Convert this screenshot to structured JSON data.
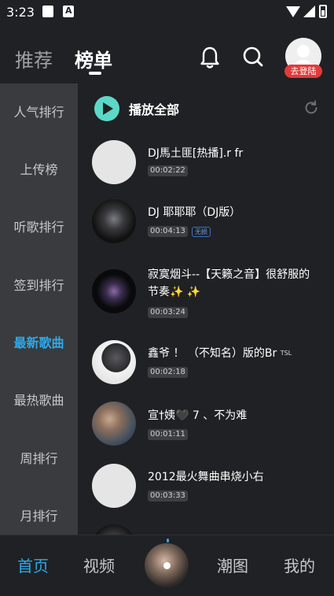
{
  "status_bar": {
    "time": "3:23"
  },
  "header": {
    "tabs": [
      {
        "label": "推荐",
        "active": false
      },
      {
        "label": "榜单",
        "active": true
      }
    ],
    "login_badge": "去登陆"
  },
  "sidebar": {
    "items": [
      {
        "label": "人气排行",
        "active": false
      },
      {
        "label": "上传榜",
        "active": false
      },
      {
        "label": "听歌排行",
        "active": false
      },
      {
        "label": "签到排行",
        "active": false
      },
      {
        "label": "最新歌曲",
        "active": true
      },
      {
        "label": "最热歌曲",
        "active": false
      },
      {
        "label": "周排行",
        "active": false
      },
      {
        "label": "月排行",
        "active": false
      }
    ]
  },
  "list": {
    "play_all_label": "播放全部",
    "songs": [
      {
        "title": "DJ馬土匪[热播].r fr",
        "duration": "00:02:22"
      },
      {
        "title": "DJ  耶耶耶（DJ版）",
        "duration": "00:04:13",
        "tag": "无损"
      },
      {
        "title": "寂寞烟斗--【天籁之音】很舒服的节奏✨ ✨",
        "duration": "00:03:24"
      },
      {
        "title": "鑫爷 ！ （不知名）版的Br",
        "title_sup": "TSL",
        "duration": "00:02:18"
      },
      {
        "title": "宣†姨🖤  7 、不为难",
        "duration": "00:01:11"
      },
      {
        "title": "2012最火舞曲串烧小右",
        "duration": "00:03:33"
      }
    ]
  },
  "bottom_nav": {
    "items": [
      {
        "label": "首页",
        "active": true
      },
      {
        "label": "视频",
        "active": false
      },
      {
        "label": "潮图",
        "active": false
      },
      {
        "label": "我的",
        "active": false
      }
    ]
  },
  "colors": {
    "accent": "#2fa9e8",
    "background": "#202124",
    "sidebar_bg": "#3a3b3e",
    "badge_red": "#e23a3a",
    "play_icon": "#5dd8c8"
  }
}
